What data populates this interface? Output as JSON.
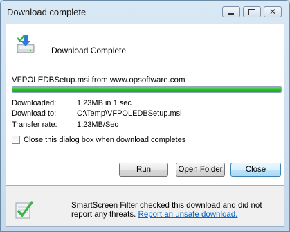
{
  "window": {
    "title": "Download complete"
  },
  "main": {
    "heading": "Download Complete",
    "source": "VFPOLEDBSetup.msi from www.opsoftware.com",
    "progress_fraction": 1.0,
    "details": [
      {
        "label": "Downloaded:",
        "value": "1.23MB in 1 sec"
      },
      {
        "label": "Download to:",
        "value": "C:\\Temp\\VFPOLEDBSetup.msi"
      },
      {
        "label": "Transfer rate:",
        "value": "1.23MB/Sec"
      }
    ],
    "close_checkbox_label": "Close this dialog box when download completes",
    "close_checkbox_checked": false
  },
  "buttons": {
    "run": "Run",
    "open_folder": "Open Folder",
    "close": "Close"
  },
  "footer": {
    "smartscreen_text": "SmartScreen Filter checked this download and did not report any threats.",
    "report_link": "Report an unsafe download."
  },
  "icons": {
    "download": "download-icon",
    "smartscreen": "smartscreen-shield-icon"
  },
  "colors": {
    "progress": "#2fbf2f",
    "link": "#0066cc"
  }
}
